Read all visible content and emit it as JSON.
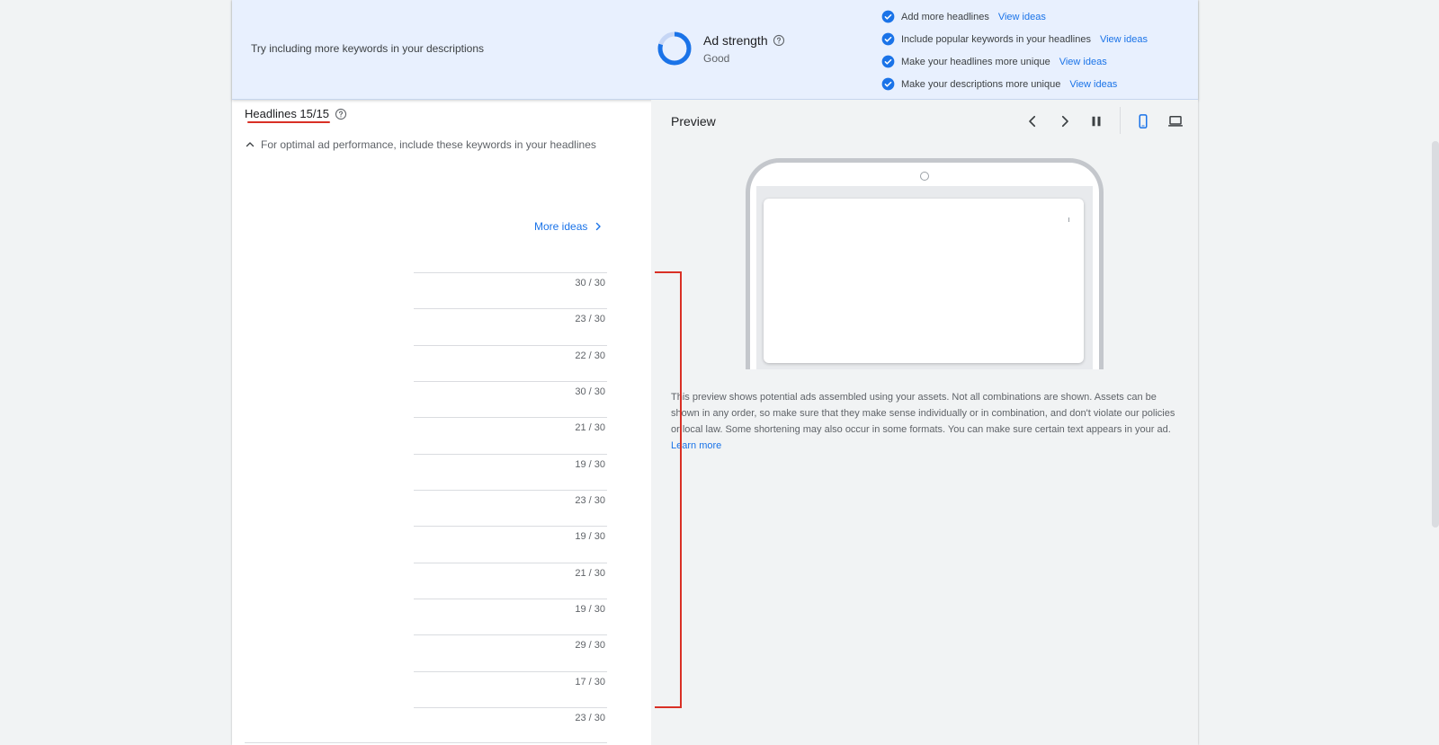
{
  "banner": {
    "tip": "Try including more keywords in your descriptions",
    "strength_title": "Ad strength",
    "strength_value": "Good",
    "checklist": [
      {
        "label": "Add more headlines",
        "link": "View ideas"
      },
      {
        "label": "Include popular keywords in your headlines",
        "link": "View ideas"
      },
      {
        "label": "Make your headlines more unique",
        "link": "View ideas"
      },
      {
        "label": "Make your descriptions more unique",
        "link": "View ideas"
      }
    ],
    "colors": {
      "accent": "#1a73e8",
      "background": "#e8f0fe"
    }
  },
  "headlines": {
    "title": "Headlines 15/15",
    "keywords_hint": "For optimal ad performance, include these keywords in your headlines",
    "more_ideas": "More ideas",
    "counters": [
      "30 / 30",
      "23 / 30",
      "22 / 30",
      "30 / 30",
      "21 / 30",
      "19 / 30",
      "23 / 30",
      "19 / 30",
      "21 / 30",
      "19 / 30",
      "29 / 30",
      "17 / 30",
      "23 / 30"
    ]
  },
  "preview": {
    "title": "Preview",
    "disclaimer": "This preview shows potential ads assembled using your assets. Not all combinations are shown. Assets can be shown in any order, so make sure that they make sense individually or in combination, and don't violate our policies or local law. Some shortening may also occur in some formats. You can make sure certain text appears in your ad.",
    "learn_more": "Learn more"
  },
  "icons": {
    "help": "help-circle-icon",
    "check": "check-circle-icon",
    "prev": "chevron-left-icon",
    "next": "chevron-right-icon",
    "pause": "pause-icon",
    "mobile": "phone-icon",
    "desktop": "laptop-icon"
  },
  "annotation_color": "#d93025"
}
